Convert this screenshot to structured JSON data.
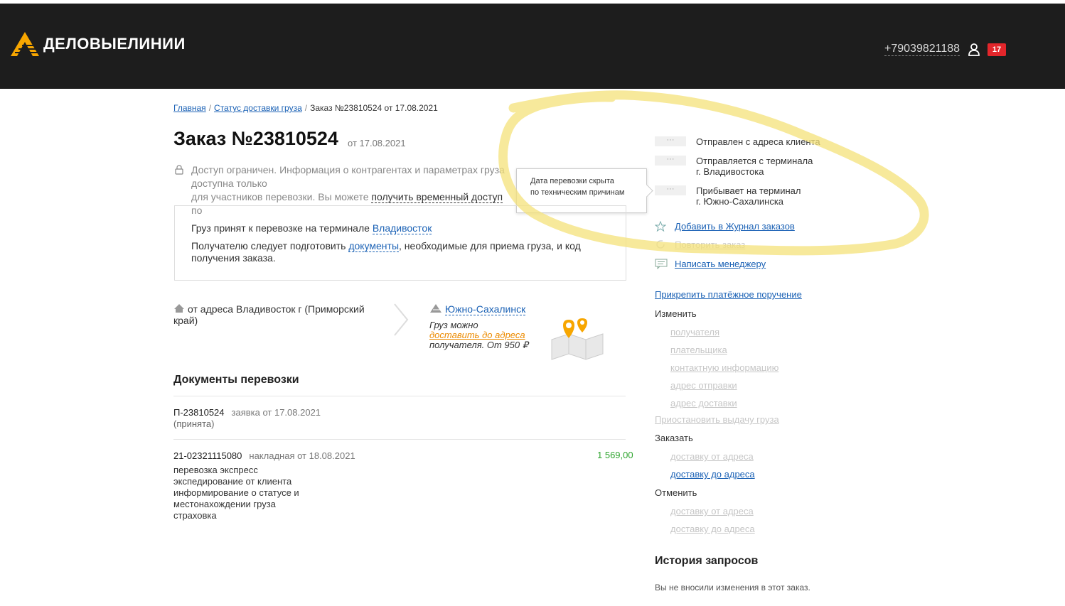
{
  "header": {
    "logo_text": "ДЕЛОВЫЕЛИНИИ",
    "phone": "+79039821188",
    "badge_count": "17",
    "colors": {
      "bg": "#1d1d1d",
      "logo_accent": "#f7a600",
      "badge": "#e3262b"
    }
  },
  "breadcrumbs": [
    {
      "label": "Главная"
    },
    {
      "label": "Статус доставки груза"
    },
    {
      "label": "Заказ №23810524 от 17.08.2021"
    }
  ],
  "order": {
    "title": "Заказ №23810524",
    "date": "от 17.08.2021"
  },
  "access_notice": {
    "line1": "Доступ ограничен. Информация о контрагентах и параметрах груза доступна только",
    "line2_prefix": "для участников перевозки. Вы можете ",
    "link": "получить временный доступ",
    "line2_suffix": " по"
  },
  "tooltip": {
    "line1": "Дата перевозки скрыта",
    "line2": "по техническим причинам"
  },
  "cargo": {
    "accepted_prefix": "Груз принят к перевозке на терминале ",
    "accepted_link": "Владивосток",
    "prepare_prefix": "Получателю следует подготовить ",
    "prepare_link": "документы",
    "prepare_suffix": ", необходимые для приема груза, и код получения заказа."
  },
  "route": {
    "from": "от адреса Владивосток г (Приморский край)",
    "to": "Южно-Сахалинск",
    "delivery_prefix": "Груз можно ",
    "delivery_link": "доставить до адреса",
    "delivery_suffix": " получателя. От 950 ₽"
  },
  "documents": {
    "title": "Документы перевозки",
    "items": [
      {
        "number": "П-23810524",
        "kind": "заявка от 17.08.2021",
        "lines": [
          "(принята)"
        ],
        "sum": ""
      },
      {
        "number": "21-02321115080",
        "kind": "накладная от 18.08.2021",
        "lines": [
          "перевозка экспресс",
          "экспедирование от клиента",
          "информирование о статусе и",
          "местонахождении груза",
          "страховка"
        ],
        "sum": "1 569,00"
      }
    ]
  },
  "status": [
    {
      "dots": "···",
      "line1": "Отправлен с адреса клиента",
      "line2": ""
    },
    {
      "dots": "···",
      "line1": "Отправляется с терминала",
      "line2": "г. Владивостока"
    },
    {
      "dots": "···",
      "line1": "Прибывает на терминал",
      "line2": "г. Южно-Сахалинска"
    }
  ],
  "actions": {
    "journal": "Добавить в Журнал заказов",
    "repeat": "Повторить заказ",
    "manager": "Написать менеджеру"
  },
  "sidebar": {
    "attach": "Прикрепить платёжное поручение",
    "change_label": "Изменить",
    "change_items": [
      "получателя",
      "плательщика",
      "контактную информацию",
      "адрес отправки",
      "адрес доставки"
    ],
    "suspend": "Приостановить выдачу груза",
    "order_label": "Заказать",
    "order_items": [
      "доставку от адреса",
      "доставку до адреса"
    ],
    "cancel_label": "Отменить",
    "cancel_items": [
      "доставку от адреса",
      "доставку до адреса"
    ]
  },
  "history": {
    "title": "История запросов",
    "text": "Вы не вносили изменения в этот заказ."
  }
}
